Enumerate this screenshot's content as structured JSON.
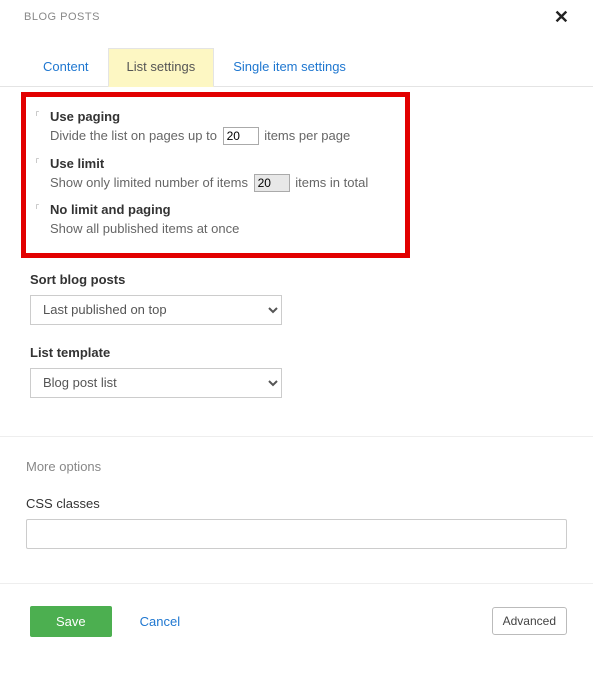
{
  "header": {
    "title": "BLOG POSTS"
  },
  "tabs": {
    "content": "Content",
    "list_settings": "List settings",
    "single_item": "Single item settings"
  },
  "paging": {
    "title": "Use paging",
    "desc_before": "Divide the list on pages up to",
    "value": "20",
    "desc_after": "items per page"
  },
  "limit": {
    "title": "Use limit",
    "desc_before": "Show only limited number of items",
    "value": "20",
    "desc_after": "items in total"
  },
  "nolimit": {
    "title": "No limit and paging",
    "desc": "Show all published items at once"
  },
  "sort": {
    "label": "Sort blog posts",
    "value": "Last published on top"
  },
  "template": {
    "label": "List template",
    "value": "Blog post list"
  },
  "more_options": "More options",
  "css": {
    "label": "CSS classes",
    "value": ""
  },
  "footer": {
    "save": "Save",
    "cancel": "Cancel",
    "advanced": "Advanced"
  }
}
